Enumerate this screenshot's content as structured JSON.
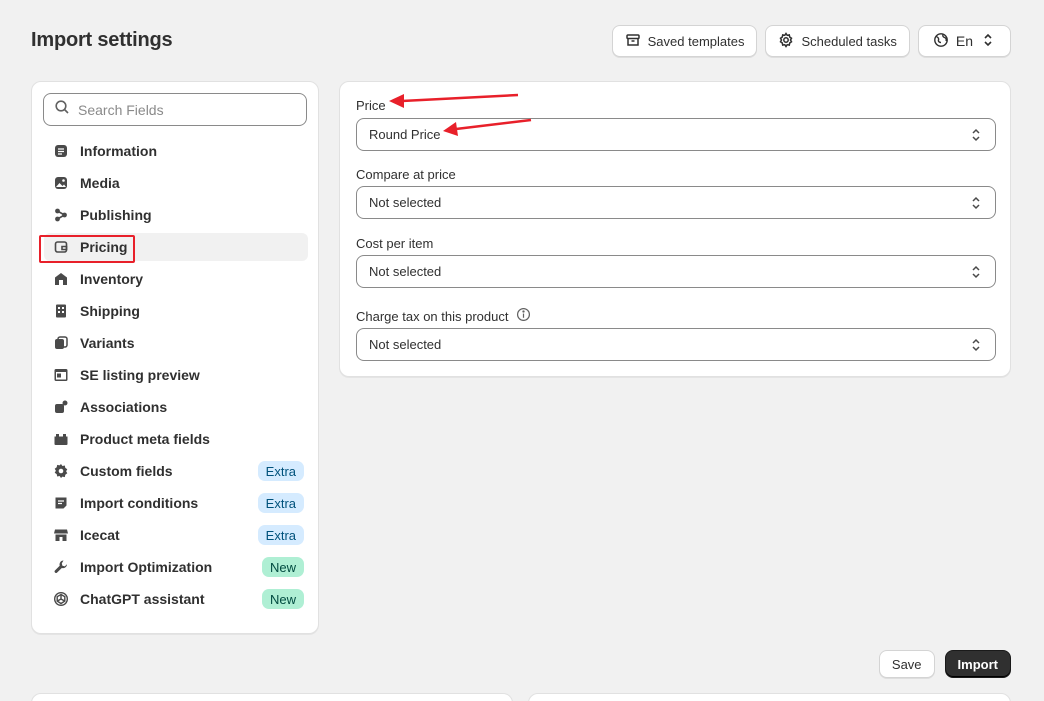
{
  "page": {
    "title": "Import settings"
  },
  "top_actions": {
    "saved_templates": "Saved templates",
    "scheduled_tasks": "Scheduled tasks",
    "language": "En"
  },
  "search": {
    "placeholder": "Search Fields"
  },
  "sidebar": {
    "items": [
      {
        "label": "Information",
        "icon": "document-icon"
      },
      {
        "label": "Media",
        "icon": "image-icon"
      },
      {
        "label": "Publishing",
        "icon": "channels-icon"
      },
      {
        "label": "Pricing",
        "icon": "wallet-icon",
        "active": true
      },
      {
        "label": "Inventory",
        "icon": "warehouse-icon"
      },
      {
        "label": "Shipping",
        "icon": "building-icon"
      },
      {
        "label": "Variants",
        "icon": "variant-icon"
      },
      {
        "label": "SE listing preview",
        "icon": "browser-icon"
      },
      {
        "label": "Associations",
        "icon": "associations-icon"
      },
      {
        "label": "Product meta fields",
        "icon": "folder-icon"
      },
      {
        "label": "Custom fields",
        "icon": "gear-icon",
        "badge": "Extra"
      },
      {
        "label": "Import conditions",
        "icon": "note-icon",
        "badge": "Extra"
      },
      {
        "label": "Icecat",
        "icon": "store-icon",
        "badge": "Extra"
      },
      {
        "label": "Import Optimization",
        "icon": "wrench-icon",
        "badge": "New"
      },
      {
        "label": "ChatGPT assistant",
        "icon": "openai-icon",
        "badge": "New"
      }
    ]
  },
  "form": {
    "price": {
      "label": "Price",
      "value": "Round Price"
    },
    "compare_at_price": {
      "label": "Compare at price",
      "value": "Not selected"
    },
    "cost_per_item": {
      "label": "Cost per item",
      "value": "Not selected"
    },
    "charge_tax": {
      "label": "Charge tax on this product",
      "value": "Not selected"
    }
  },
  "footer": {
    "save": "Save",
    "import": "Import"
  },
  "colors": {
    "annotation": "#e8202a",
    "primary_button": "#303030",
    "extra_badge": "#d5ebff",
    "new_badge": "#afefd4"
  }
}
